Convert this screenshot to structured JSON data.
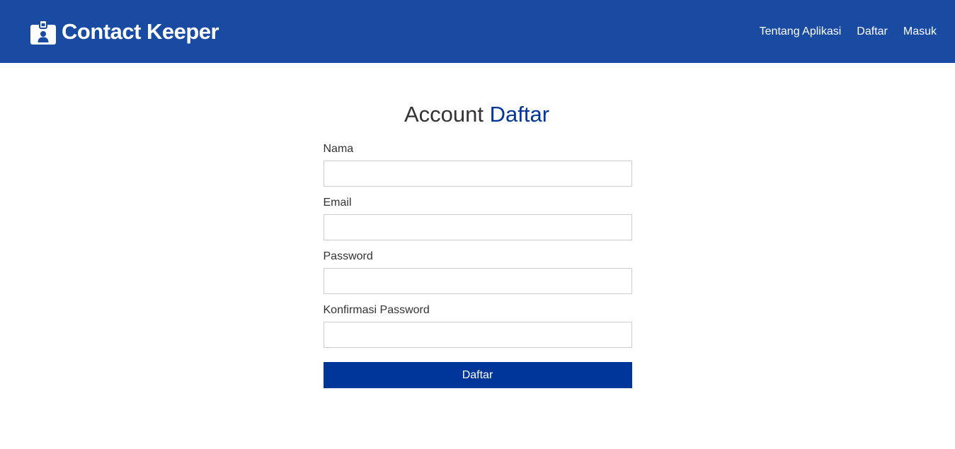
{
  "colors": {
    "navbar_bg": "#1a4ba3",
    "accent": "#003699",
    "text": "#333333",
    "input_border": "#cccccc"
  },
  "navbar": {
    "brand_icon": "id-badge-icon",
    "brand_title": "Contact Keeper",
    "links": [
      {
        "label": "Tentang Aplikasi"
      },
      {
        "label": "Daftar"
      },
      {
        "label": "Masuk"
      }
    ]
  },
  "page": {
    "title_prefix": "Account",
    "title_accent": "Daftar"
  },
  "form": {
    "fields": [
      {
        "label": "Nama",
        "value": "",
        "placeholder": ""
      },
      {
        "label": "Email",
        "value": "",
        "placeholder": ""
      },
      {
        "label": "Password",
        "value": "",
        "placeholder": ""
      },
      {
        "label": "Konfirmasi Password",
        "value": "",
        "placeholder": ""
      }
    ],
    "submit_label": "Daftar"
  }
}
